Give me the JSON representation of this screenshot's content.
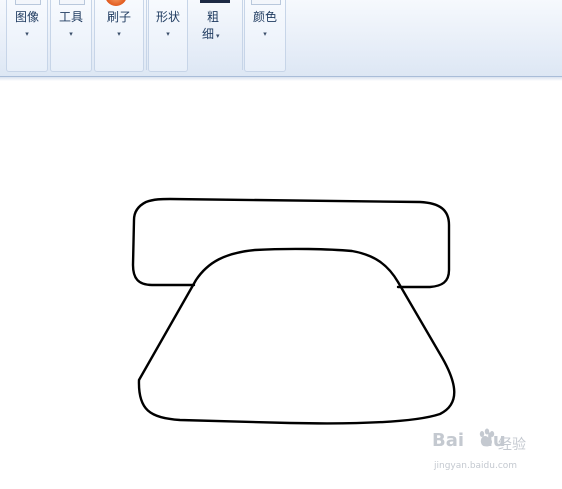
{
  "ribbon": {
    "groups": [
      {
        "id": "image",
        "label": "图像",
        "arrow": "▾"
      },
      {
        "id": "tools",
        "label": "工具",
        "arrow": "▾"
      },
      {
        "id": "brushes",
        "label": "刷子",
        "arrow": "▾"
      },
      {
        "id": "shapes",
        "label": "形状",
        "arrow": "▾"
      },
      {
        "id": "size",
        "label_line1": "粗",
        "label_line2": "细",
        "arrow": "▾"
      },
      {
        "id": "colors",
        "label": "颜色",
        "arrow": "▾"
      }
    ]
  },
  "canvas": {
    "drawing": "telephone-outline",
    "stroke_color": "#000000",
    "background": "#ffffff"
  },
  "watermark": {
    "brand": "Bai",
    "brand_suffix": "du",
    "cn": "经验",
    "url": "jingyan.baidu.com"
  },
  "colors": {
    "ribbon_text": "#1e3a5f",
    "ribbon_border": "#c7d5e8"
  }
}
